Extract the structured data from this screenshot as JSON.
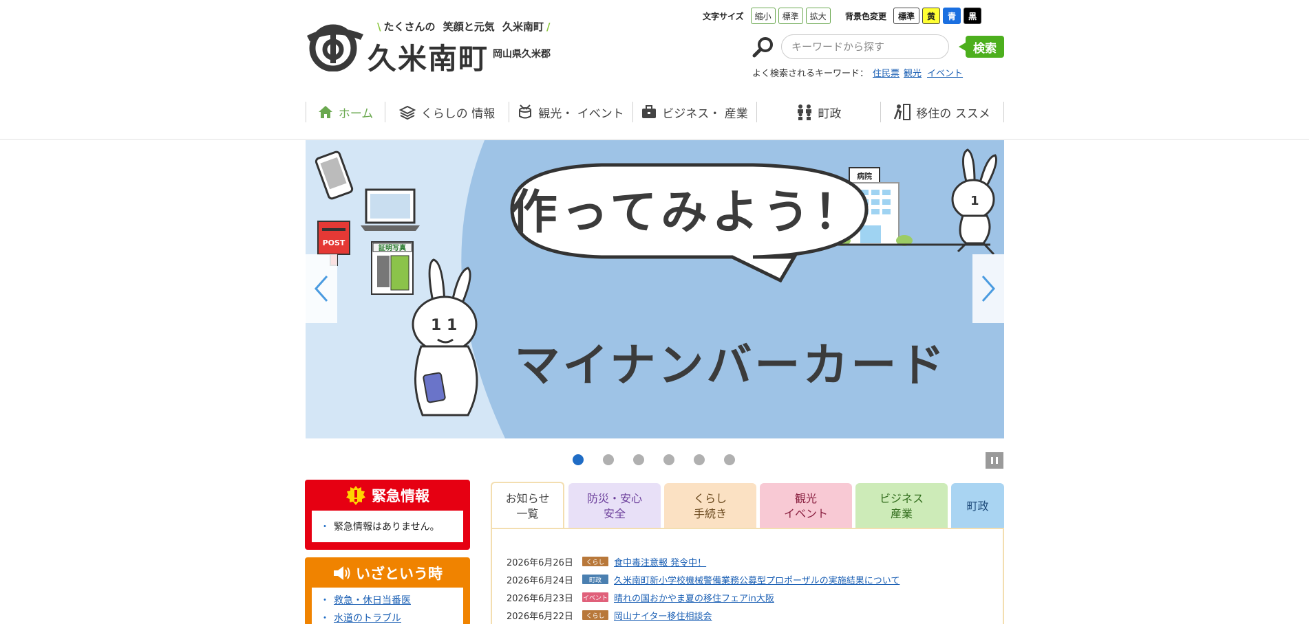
{
  "header": {
    "tagline": [
      "たくさんの",
      "笑顔と元気",
      "久米南町"
    ],
    "town_name": "久米南町",
    "prefecture": "岡山県久米郡",
    "font_size": {
      "label": "文字サイズ",
      "buttons": [
        "縮小",
        "標準",
        "拡大"
      ]
    },
    "bg_color": {
      "label": "背景色変更",
      "buttons": [
        {
          "label": "標準",
          "bg": "#ffffff",
          "fg": "#222222"
        },
        {
          "label": "黄",
          "bg": "#ffff33",
          "fg": "#222222"
        },
        {
          "label": "青",
          "bg": "#1a6fe0",
          "fg": "#ffffff"
        },
        {
          "label": "黒",
          "bg": "#000000",
          "fg": "#ffffff"
        }
      ]
    },
    "search": {
      "placeholder": "キーワードから探す",
      "button": "検索",
      "keywords_label": "よく検索されるキーワード：",
      "keywords": [
        "住民票",
        "観光",
        "イベント"
      ]
    }
  },
  "nav": [
    {
      "label": "ホーム",
      "icon": "home-icon",
      "active": true
    },
    {
      "label": "くらしの 情報",
      "icon": "books-icon",
      "active": false
    },
    {
      "label": "観光・ イベント",
      "icon": "drum-icon",
      "active": false
    },
    {
      "label": "ビジネス・ 産業",
      "icon": "briefcase-icon",
      "active": false
    },
    {
      "label": "町政",
      "icon": "people-icon",
      "active": false
    },
    {
      "label": "移住の ススメ",
      "icon": "walking-icon",
      "active": false
    }
  ],
  "hero": {
    "headline": "作ってみよう！",
    "subtitle": "マイナンバーカード",
    "post_label": "POST",
    "photo_label": "証明写真",
    "hospital_label": "病院",
    "slide_count": 6,
    "active_slide": 0
  },
  "emergency": {
    "title": "緊急情報",
    "message": "緊急情報はありません。"
  },
  "izato": {
    "title": "いざという時",
    "links": [
      "救急・休日当番医",
      "水道のトラブル"
    ]
  },
  "news": {
    "tabs": [
      {
        "label": [
          "お知らせ",
          "一覧"
        ],
        "bg": "#ffffff",
        "fg": "#444444"
      },
      {
        "label": [
          "防災・安心",
          "安全"
        ],
        "bg": "#e8e0f7",
        "fg": "#6a3d9a"
      },
      {
        "label": [
          "くらし",
          "手続き"
        ],
        "bg": "#fbe1c3",
        "fg": "#6b4a1f"
      },
      {
        "label": [
          "観光",
          "イベント"
        ],
        "bg": "#f8c9d4",
        "fg": "#8a2040"
      },
      {
        "label": [
          "ビジネス",
          "産業"
        ],
        "bg": "#cdebb8",
        "fg": "#2f6b1a"
      },
      {
        "label": [
          "町政"
        ],
        "bg": "#a9d4f2",
        "fg": "#1d4a7a"
      }
    ],
    "items": [
      {
        "date": "2026年6月26日",
        "tag": "くらし",
        "tag_color": "#b8783a",
        "title": "食中毒注意報 発令中！"
      },
      {
        "date": "2026年6月24日",
        "tag": "町政",
        "tag_color": "#4a7fb0",
        "title": "久米南町新小学校機械警備業務公募型プロポーザルの実施結果について"
      },
      {
        "date": "2026年6月23日",
        "tag": "イベント",
        "tag_color": "#e0607a",
        "title": "晴れの国おかやま夏の移住フェアin大阪"
      },
      {
        "date": "2026年6月22日",
        "tag": "くらし",
        "tag_color": "#b8783a",
        "title": "岡山ナイター移住相談会"
      }
    ]
  }
}
